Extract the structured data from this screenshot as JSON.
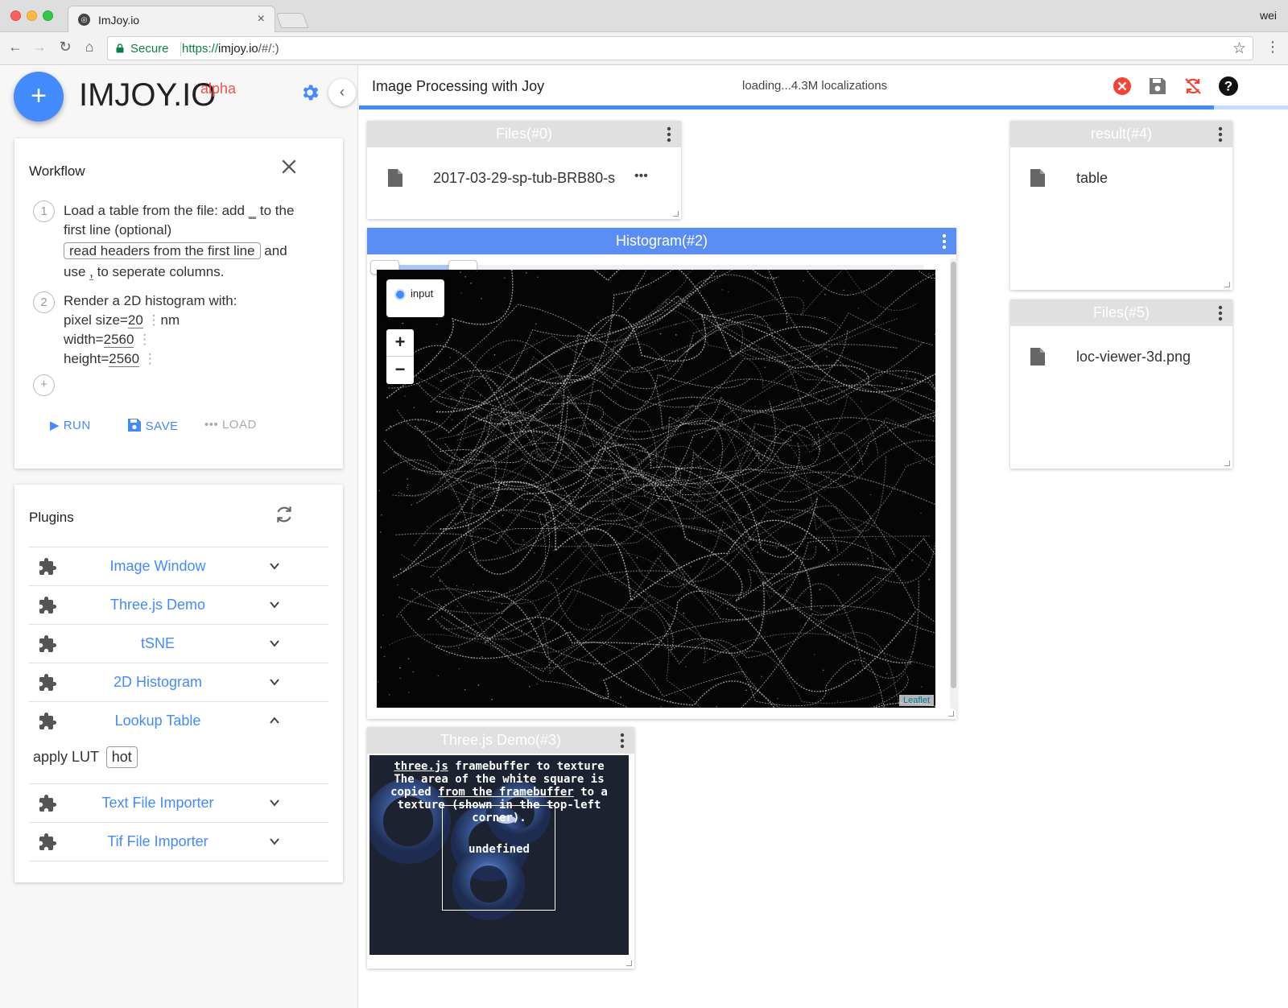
{
  "browser": {
    "tab_title": "ImJoy.io",
    "user": "wei",
    "secure_label": "Secure",
    "url_scheme": "https://",
    "url_host": "imjoy.io",
    "url_path": "/#/:)"
  },
  "sidebar": {
    "logo": "IMJOY.IO",
    "logo_suffix": "alpha",
    "workflow": {
      "title": "Workflow",
      "step1": {
        "number": "1",
        "text_a": "Load a table from the file: add",
        "text_a_field": "_",
        "text_a2": "to the",
        "text_b": "first line (optional)",
        "chip": "read headers from the first line",
        "text_c": "and",
        "text_d": "use",
        "text_d_field": ",",
        "text_d2": "to seperate columns."
      },
      "step2": {
        "number": "2",
        "text": "Render a 2D histogram with:",
        "pixel_size_label": "pixel size=",
        "pixel_size_value": "20",
        "pixel_size_unit": "nm",
        "width_label": "width=",
        "width_value": "2560",
        "height_label": "height=",
        "height_value": "2560"
      },
      "actions": {
        "run": "RUN",
        "save": "SAVE",
        "load": "LOAD"
      }
    },
    "plugins": {
      "title": "Plugins",
      "items": [
        {
          "label": "Image Window"
        },
        {
          "label": "Three.js Demo"
        },
        {
          "label": "tSNE"
        },
        {
          "label": "2D Histogram"
        },
        {
          "label": "Lookup Table"
        },
        {
          "label": "Text File Importer"
        },
        {
          "label": "Tif File Importer"
        }
      ],
      "lut": {
        "label": "apply LUT",
        "value": "hot"
      }
    }
  },
  "main": {
    "title": "Image Processing with Joy",
    "status": "loading...4.3M localizations",
    "progress": 0.92,
    "windows": {
      "files0": {
        "title": "Files(#0)",
        "file": "2017-03-29-sp-tub-BRB80-s"
      },
      "result4": {
        "title": "result(#4)",
        "file": "table"
      },
      "files5": {
        "title": "Files(#5)",
        "file": "loc-viewer-3d.png"
      },
      "histogram": {
        "title": "Histogram(#2)",
        "layer": "input",
        "zoom_in": "+",
        "zoom_out": "−",
        "attribution": "Leaflet"
      },
      "threejs": {
        "title": "Three.js Demo(#3)",
        "line1_link": "three.js",
        "line1_rest": " framebuffer to texture",
        "line2": "The area of the white square is",
        "line3_a": "copied ",
        "line3_link": "from the framebuffer",
        "line3_b": " to a",
        "line4": "texture (shown in the top-left",
        "line5": "corner).",
        "output": "undefined"
      }
    }
  },
  "colors": {
    "accent": "#448aff",
    "logo_suffix": "#ef5350",
    "window_header": "#e0e0e0",
    "window_header_active": "#5a8ef5"
  }
}
